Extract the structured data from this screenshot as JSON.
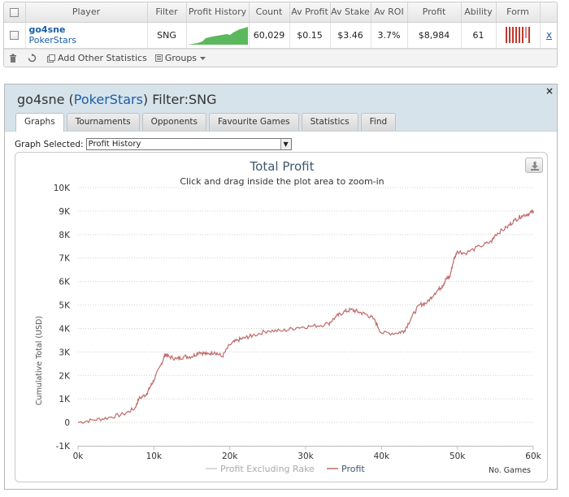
{
  "table": {
    "headers": [
      "Player",
      "Filter",
      "Profit History",
      "Count",
      "Av Profit",
      "Av Stake",
      "Av ROI",
      "Profit",
      "Ability",
      "Form"
    ],
    "row": {
      "player_name": "go4sne",
      "player_site": "PokerStars",
      "filter": "SNG",
      "count": "60,029",
      "av_profit": "$0.15",
      "av_stake": "$3.46",
      "av_roi": "3.7%",
      "profit": "$8,984",
      "ability": "61",
      "remove_label": "x"
    }
  },
  "toolbar": {
    "add_stats_label": "Add Other Statistics",
    "groups_label": "Groups"
  },
  "window": {
    "title_name": "go4sne",
    "title_open_paren": " (",
    "title_site": "PokerStars",
    "title_rest": ") Filter:SNG",
    "close_label": "×",
    "tabs": [
      "Graphs",
      "Tournaments",
      "Opponents",
      "Favourite Games",
      "Statistics",
      "Find"
    ],
    "graph_selected_label": "Graph Selected:",
    "graph_selected_value": "Profit History"
  },
  "colors": {
    "accent_link": "#1a5ea8",
    "series_profit": "#c06a6a",
    "series_rake": "#cccccc",
    "form_bar": "#c0392b",
    "spark_fill": "#5cb85c"
  },
  "chart_data": {
    "type": "line",
    "title": "Total Profit",
    "subtitle": "Click and drag inside the plot area to zoom-in",
    "ylabel": "Cumulative Total (USD)",
    "xlabel": "No. Games",
    "xlim": [
      0,
      60000
    ],
    "ylim": [
      -1000,
      10000
    ],
    "x_ticks": [
      "0k",
      "10k",
      "20k",
      "30k",
      "40k",
      "50k",
      "60k"
    ],
    "y_ticks": [
      "-1K",
      "0",
      "1K",
      "2K",
      "3K",
      "4K",
      "5K",
      "6K",
      "7K",
      "8K",
      "9K",
      "10K"
    ],
    "grid": true,
    "legend": "bottom-center",
    "series": [
      {
        "name": "Profit Excluding Rake",
        "x": [],
        "y": []
      },
      {
        "name": "Profit",
        "x": [
          0,
          2000,
          4000,
          6000,
          7500,
          8000,
          9000,
          9500,
          10000,
          11000,
          11500,
          12000,
          13000,
          14000,
          15000,
          16000,
          17000,
          18000,
          19000,
          20000,
          21000,
          22000,
          23000,
          25000,
          27000,
          29000,
          31000,
          33000,
          34000,
          35000,
          36000,
          37000,
          38000,
          39000,
          40000,
          42000,
          43000,
          44000,
          45000,
          46000,
          47000,
          48000,
          48500,
          49000,
          49500,
          50000,
          51000,
          53000,
          54500,
          55000,
          56500,
          57500,
          58500,
          59500,
          60029
        ],
        "y": [
          0,
          100,
          200,
          350,
          600,
          1000,
          1200,
          1500,
          1800,
          2500,
          2900,
          2800,
          2700,
          2800,
          2800,
          3000,
          2900,
          3000,
          2800,
          3300,
          3500,
          3600,
          3700,
          3900,
          3900,
          4050,
          4100,
          4200,
          4500,
          4700,
          4800,
          4700,
          4600,
          4400,
          3800,
          3800,
          3900,
          4500,
          5000,
          5100,
          5500,
          5800,
          6100,
          6200,
          6900,
          7300,
          7200,
          7500,
          7700,
          8000,
          8300,
          8600,
          8800,
          8900,
          9000
        ]
      }
    ]
  }
}
